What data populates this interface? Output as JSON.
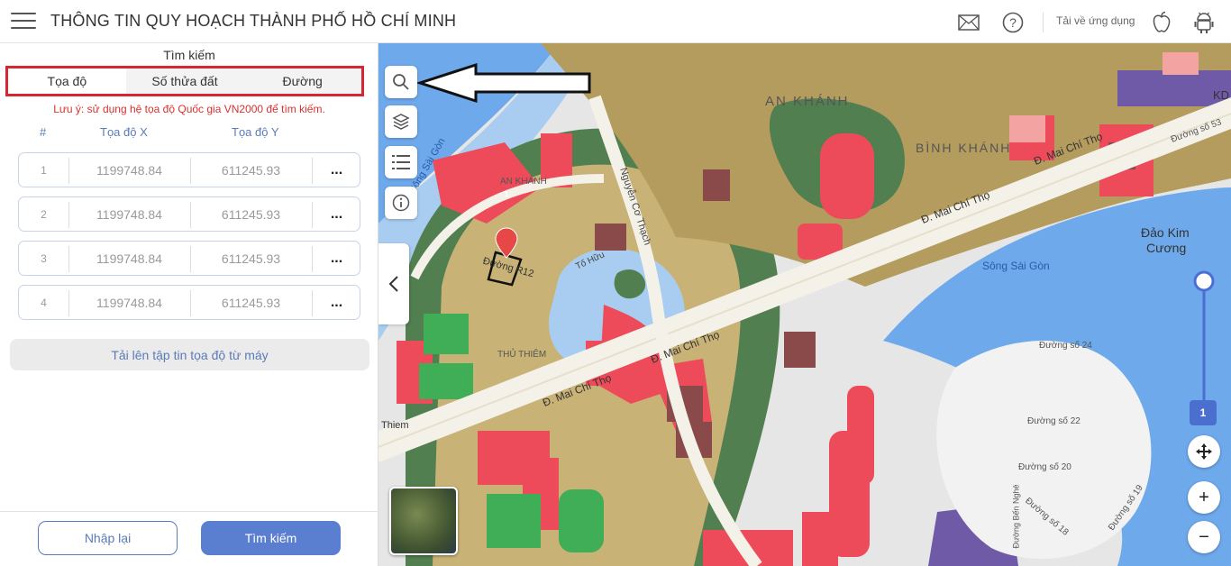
{
  "header": {
    "title": "THÔNG TIN QUY HOẠCH THÀNH PHỐ HỒ CHÍ MINH",
    "download_label": "Tải về ứng dụng"
  },
  "panel": {
    "title": "Tìm kiếm",
    "tabs": [
      {
        "label": "Tọa độ",
        "active": true
      },
      {
        "label": "Số thửa đất",
        "active": false
      },
      {
        "label": "Đường",
        "active": false
      }
    ],
    "note": "Lưu ý: sử dụng hệ tọa độ Quốc gia VN2000 để tìm kiếm.",
    "columns": {
      "index": "#",
      "x": "Tọa độ X",
      "y": "Tọa độ Y"
    },
    "rows": [
      {
        "index": "1",
        "x": "1199748.84",
        "y": "611245.93",
        "more": "..."
      },
      {
        "index": "2",
        "x": "1199748.84",
        "y": "611245.93",
        "more": "..."
      },
      {
        "index": "3",
        "x": "1199748.84",
        "y": "611245.93",
        "more": "..."
      },
      {
        "index": "4",
        "x": "1199748.84",
        "y": "611245.93",
        "more": "..."
      }
    ],
    "upload_label": "Tải lên tập tin tọa độ từ máy",
    "reset_label": "Nhập lại",
    "search_label": "Tìm kiếm"
  },
  "map": {
    "labels": {
      "an_khanh": "AN KHÁNH",
      "binh_khanh": "BÌNH KHÁNH",
      "an_khanh_small": "AN KHÁNH",
      "thu_thiem": "THỦ THIÊM",
      "dao_kim_cuong_1": "Đảo Kim",
      "dao_kim_cuong_2": "Cương",
      "song_sai_gon": "Sông Sài Gòn",
      "song_sai_gon_left": "Sông Sài Gòn",
      "mai_chi_tho_1": "Đ. Mai Chí Thọ",
      "mai_chi_tho_2": "Đ. Mai Chí Thọ",
      "mai_chi_tho_3": "Đ. Mai Chí Thọ",
      "mai_chi_tho_4": "Đ. Mai Chí Thọ",
      "nguyen_co_thach": "Nguyễn Cơ Thạch",
      "duong_r12": "Đường R12",
      "to_huu": "Tố Hữu",
      "kd": "KD",
      "duong_so_24": "Đường số 24",
      "duong_so_22": "Đường số 22",
      "duong_so_20": "Đường số 20",
      "duong_so_19": "Đường số 19",
      "duong_so_18": "Đường số 18",
      "duong_so_53": "Đường số 53",
      "ben_nghe": "Đường Bến Nghé",
      "thiem": "Thiem"
    },
    "marker_number": "1",
    "zoom_level": "1",
    "zoom_in": "+",
    "zoom_out": "−"
  },
  "colors": {
    "accent": "#5a7ed0",
    "alert": "#d9312e",
    "tab_border": "#d62633",
    "water": "#a9cdf0",
    "river": "#6ea9ec",
    "green": "#527f4f",
    "residential": "#b49b5e",
    "commercial": "#ee4b5a",
    "road": "#f4f1e8",
    "park": "#3fae57",
    "purple": "#6f5aa7"
  }
}
